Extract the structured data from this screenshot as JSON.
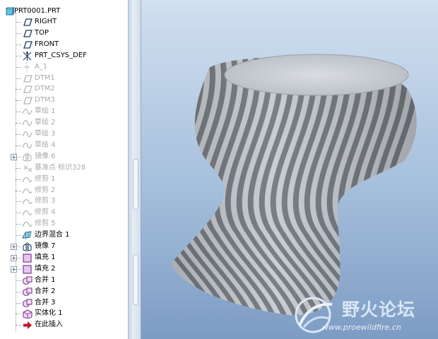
{
  "model_tree": {
    "root_label": "PRT0001.PRT",
    "items": [
      {
        "label": "RIGHT",
        "icon": "datum-plane-icon",
        "state": "active",
        "expander": ""
      },
      {
        "label": "TOP",
        "icon": "datum-plane-icon",
        "state": "active",
        "expander": ""
      },
      {
        "label": "FRONT",
        "icon": "datum-plane-icon",
        "state": "active",
        "expander": ""
      },
      {
        "label": "PRT_CSYS_DEF",
        "icon": "csys-icon",
        "state": "active",
        "expander": ""
      },
      {
        "label": "A_1",
        "icon": "axis-icon",
        "state": "dim",
        "expander": ""
      },
      {
        "label": "DTM1",
        "icon": "datum-plane-icon",
        "state": "dim",
        "expander": ""
      },
      {
        "label": "DTM2",
        "icon": "datum-plane-icon",
        "state": "dim",
        "expander": ""
      },
      {
        "label": "DTM3",
        "icon": "datum-plane-icon",
        "state": "dim",
        "expander": ""
      },
      {
        "label": "草绘 1",
        "icon": "sketch-icon",
        "state": "dim",
        "expander": ""
      },
      {
        "label": "草绘 2",
        "icon": "sketch-icon",
        "state": "dim",
        "expander": ""
      },
      {
        "label": "草绘 3",
        "icon": "sketch-icon",
        "state": "dim",
        "expander": ""
      },
      {
        "label": "草绘 4",
        "icon": "sketch-icon",
        "state": "dim",
        "expander": ""
      },
      {
        "label": "镜像 6",
        "icon": "mirror-icon",
        "state": "dim",
        "expander": "+"
      },
      {
        "label": "基准点 标识328",
        "icon": "datum-point-icon",
        "state": "dim",
        "expander": ""
      },
      {
        "label": "修剪 1",
        "icon": "trim-icon",
        "state": "dim",
        "expander": ""
      },
      {
        "label": "修剪 2",
        "icon": "trim-icon",
        "state": "dim",
        "expander": ""
      },
      {
        "label": "修剪 3",
        "icon": "trim-icon",
        "state": "dim",
        "expander": ""
      },
      {
        "label": "修剪 4",
        "icon": "trim-icon",
        "state": "dim",
        "expander": ""
      },
      {
        "label": "修剪 5",
        "icon": "trim-icon",
        "state": "dim",
        "expander": ""
      },
      {
        "label": "边界混合 1",
        "icon": "boundary-blend-icon",
        "state": "active",
        "expander": ""
      },
      {
        "label": "镜像 7",
        "icon": "mirror-icon",
        "state": "active",
        "expander": "+"
      },
      {
        "label": "填充 1",
        "icon": "fill-icon",
        "state": "active",
        "expander": "+"
      },
      {
        "label": "填充 2",
        "icon": "fill-icon",
        "state": "active",
        "expander": "+"
      },
      {
        "label": "合并 1",
        "icon": "merge-icon",
        "state": "active",
        "expander": ""
      },
      {
        "label": "合并 2",
        "icon": "merge-icon",
        "state": "active",
        "expander": ""
      },
      {
        "label": "合并 3",
        "icon": "merge-icon",
        "state": "active",
        "expander": ""
      },
      {
        "label": "实体化 1",
        "icon": "solidify-icon",
        "state": "active",
        "expander": ""
      },
      {
        "label": "在此插入",
        "icon": "insert-here-arrow-icon",
        "state": "active",
        "expander": ""
      }
    ]
  },
  "watermark": {
    "title": "野火论坛",
    "url": "www.proewildfire.cn"
  },
  "colors": {
    "viewport_top": "#d2e0f0",
    "viewport_bottom": "#7d9cc4",
    "stripe_dark": "#7a7f86",
    "stripe_light": "#c9ced3",
    "insert_arrow": "#c8102e"
  }
}
